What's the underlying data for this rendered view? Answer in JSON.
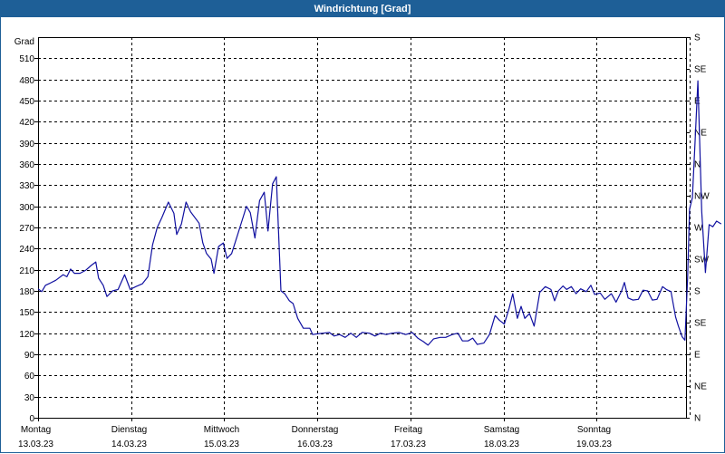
{
  "chart_data": {
    "type": "line",
    "title": "Windrichtung [Grad]",
    "ylabel": "Grad",
    "ylim": [
      0,
      540
    ],
    "yticks": [
      0,
      30,
      60,
      90,
      120,
      150,
      180,
      210,
      240,
      270,
      300,
      330,
      360,
      390,
      420,
      450,
      480,
      510
    ],
    "right_axis_labels": [
      "N",
      "NE",
      "E",
      "SE",
      "S",
      "SW",
      "W",
      "NW",
      "N",
      "NE",
      "E",
      "SE",
      "S"
    ],
    "x_categories": [
      {
        "day": "Montag",
        "date": "13.03.23"
      },
      {
        "day": "Dienstag",
        "date": "14.03.23"
      },
      {
        "day": "Mittwoch",
        "date": "15.03.23"
      },
      {
        "day": "Donnerstag",
        "date": "16.03.23"
      },
      {
        "day": "Freitag",
        "date": "17.03.23"
      },
      {
        "day": "Samstag",
        "date": "18.03.23"
      },
      {
        "day": "Sonntag",
        "date": "19.03.23"
      }
    ],
    "xlim_days": [
      0,
      7
    ],
    "grid": true,
    "colors": {
      "line": "#1010a0",
      "frame": "#1e5f97",
      "grid": "#000000"
    },
    "series": [
      {
        "points": [
          [
            0.0,
            183
          ],
          [
            0.04,
            179
          ],
          [
            0.08,
            188
          ],
          [
            0.13,
            191
          ],
          [
            0.19,
            195
          ],
          [
            0.27,
            203
          ],
          [
            0.31,
            200
          ],
          [
            0.35,
            211
          ],
          [
            0.39,
            205
          ],
          [
            0.45,
            205
          ],
          [
            0.51,
            209
          ],
          [
            0.57,
            216
          ],
          [
            0.62,
            221
          ],
          [
            0.65,
            198
          ],
          [
            0.7,
            188
          ],
          [
            0.74,
            172
          ],
          [
            0.8,
            180
          ],
          [
            0.86,
            182
          ],
          [
            0.93,
            203
          ],
          [
            0.99,
            182
          ],
          [
            1.05,
            186
          ],
          [
            1.12,
            190
          ],
          [
            1.18,
            200
          ],
          [
            1.23,
            245
          ],
          [
            1.28,
            270
          ],
          [
            1.33,
            284
          ],
          [
            1.4,
            306
          ],
          [
            1.46,
            290
          ],
          [
            1.49,
            260
          ],
          [
            1.54,
            275
          ],
          [
            1.59,
            306
          ],
          [
            1.64,
            292
          ],
          [
            1.73,
            276
          ],
          [
            1.77,
            248
          ],
          [
            1.81,
            233
          ],
          [
            1.86,
            225
          ],
          [
            1.89,
            205
          ],
          [
            1.94,
            243
          ],
          [
            1.99,
            248
          ],
          [
            2.03,
            226
          ],
          [
            2.08,
            233
          ],
          [
            2.14,
            258
          ],
          [
            2.19,
            279
          ],
          [
            2.24,
            300
          ],
          [
            2.28,
            291
          ],
          [
            2.33,
            255
          ],
          [
            2.38,
            308
          ],
          [
            2.43,
            320
          ],
          [
            2.47,
            265
          ],
          [
            2.52,
            332
          ],
          [
            2.56,
            342
          ],
          [
            2.61,
            180
          ],
          [
            2.65,
            176
          ],
          [
            2.7,
            166
          ],
          [
            2.74,
            162
          ],
          [
            2.79,
            141
          ],
          [
            2.85,
            127
          ],
          [
            2.92,
            127
          ],
          [
            2.95,
            118
          ],
          [
            3.0,
            119
          ],
          [
            3.06,
            120
          ],
          [
            3.13,
            121
          ],
          [
            3.18,
            116
          ],
          [
            3.24,
            118
          ],
          [
            3.3,
            114
          ],
          [
            3.36,
            120
          ],
          [
            3.42,
            114
          ],
          [
            3.48,
            121
          ],
          [
            3.56,
            120
          ],
          [
            3.62,
            116
          ],
          [
            3.68,
            120
          ],
          [
            3.74,
            118
          ],
          [
            3.8,
            120
          ],
          [
            3.88,
            121
          ],
          [
            3.95,
            118
          ],
          [
            4.02,
            121
          ],
          [
            4.08,
            113
          ],
          [
            4.14,
            108
          ],
          [
            4.19,
            103
          ],
          [
            4.25,
            112
          ],
          [
            4.32,
            114
          ],
          [
            4.38,
            114
          ],
          [
            4.45,
            118
          ],
          [
            4.51,
            120
          ],
          [
            4.56,
            109
          ],
          [
            4.62,
            109
          ],
          [
            4.67,
            113
          ],
          [
            4.72,
            104
          ],
          [
            4.79,
            106
          ],
          [
            4.85,
            118
          ],
          [
            4.91,
            145
          ],
          [
            4.96,
            138
          ],
          [
            5.01,
            133
          ],
          [
            5.06,
            155
          ],
          [
            5.1,
            176
          ],
          [
            5.15,
            141
          ],
          [
            5.19,
            158
          ],
          [
            5.23,
            141
          ],
          [
            5.28,
            148
          ],
          [
            5.33,
            130
          ],
          [
            5.39,
            178
          ],
          [
            5.45,
            186
          ],
          [
            5.51,
            182
          ],
          [
            5.55,
            166
          ],
          [
            5.59,
            180
          ],
          [
            5.64,
            187
          ],
          [
            5.68,
            182
          ],
          [
            5.73,
            186
          ],
          [
            5.78,
            176
          ],
          [
            5.83,
            183
          ],
          [
            5.89,
            179
          ],
          [
            5.94,
            188
          ],
          [
            5.98,
            175
          ],
          [
            6.04,
            177
          ],
          [
            6.09,
            168
          ],
          [
            6.16,
            176
          ],
          [
            6.21,
            164
          ],
          [
            6.27,
            180
          ],
          [
            6.3,
            192
          ],
          [
            6.34,
            170
          ],
          [
            6.39,
            167
          ],
          [
            6.45,
            168
          ],
          [
            6.5,
            181
          ],
          [
            6.55,
            180
          ],
          [
            6.6,
            167
          ],
          [
            6.65,
            168
          ],
          [
            6.71,
            186
          ],
          [
            6.75,
            182
          ],
          [
            6.8,
            179
          ],
          [
            6.85,
            143
          ],
          [
            6.88,
            130
          ],
          [
            6.92,
            115
          ],
          [
            6.95,
            110
          ],
          [
            6.98,
            200
          ],
          [
            7.0,
            296
          ],
          [
            7.03,
            312
          ],
          [
            7.06,
            395
          ],
          [
            7.09,
            478
          ],
          [
            7.13,
            293
          ],
          [
            7.17,
            206
          ],
          [
            7.21,
            274
          ],
          [
            7.25,
            271
          ],
          [
            7.29,
            279
          ],
          [
            7.34,
            275
          ]
        ]
      }
    ]
  }
}
